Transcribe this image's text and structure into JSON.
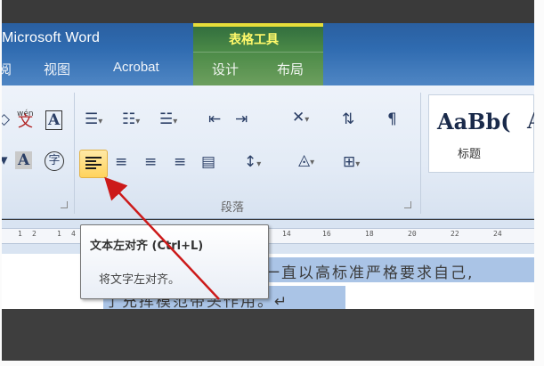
{
  "window": {
    "title": "Microsoft Word"
  },
  "tabs": [
    {
      "label": "阅"
    },
    {
      "label": "视图"
    },
    {
      "label": "Acrobat"
    },
    {
      "label": "设计"
    },
    {
      "label": "布局"
    }
  ],
  "contextual_group": {
    "label": "表格工具",
    "color": "#4b8a47"
  },
  "ribbon": {
    "font_icons": {
      "phonetic": "wén",
      "phonetic_char": "文",
      "border_char": "A",
      "shade_char": "A",
      "enclose_char": "字"
    },
    "paragraph_group_label": "段落",
    "styles": {
      "sample": "AaBb(",
      "sample_next": "A",
      "name": "标题"
    }
  },
  "ruler": {
    "ticks": [
      "1",
      "2",
      "1",
      "4",
      "14",
      "16",
      "18",
      "20",
      "22",
      "24"
    ]
  },
  "document": {
    "line1": "一直以高标准严格要求自己,",
    "line2": "了充挥模范带头作用。↵"
  },
  "tooltip": {
    "title": "文本左对齐 (Ctrl+L)",
    "body": "将文字左对齐。"
  },
  "accent_colors": {
    "title_bar": "#2f6bb0",
    "selection": "#aac4e6",
    "arrow": "#cc1a1a",
    "highlight": "#ffd35c"
  }
}
